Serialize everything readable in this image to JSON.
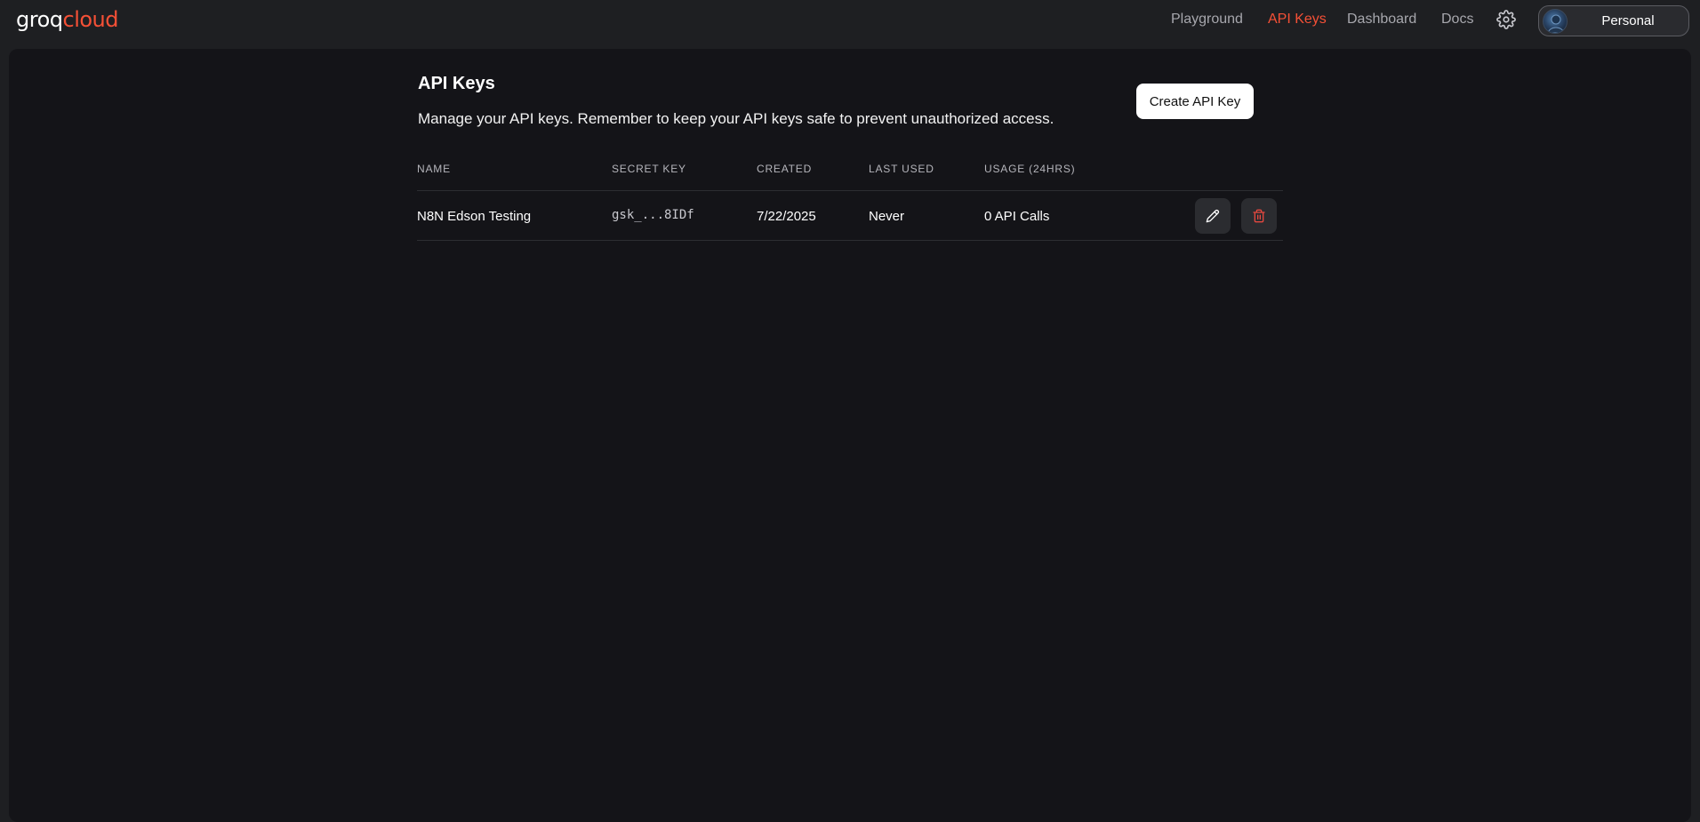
{
  "brand": {
    "part1": "groq",
    "part2": "cloud"
  },
  "nav": {
    "playground": "Playground",
    "api_keys": "API Keys",
    "dashboard": "Dashboard",
    "docs": "Docs",
    "active": "API Keys"
  },
  "account": {
    "label": "Personal"
  },
  "page": {
    "title": "API Keys",
    "description": "Manage your API keys. Remember to keep your API keys safe to prevent unauthorized access.",
    "create_button": "Create API Key"
  },
  "table": {
    "headers": {
      "name": "NAME",
      "secret_key": "SECRET KEY",
      "created": "CREATED",
      "last_used": "LAST USED",
      "usage": "USAGE (24HRS)"
    },
    "rows": [
      {
        "name": "N8N Edson Testing",
        "secret_key": "gsk_...8IDf",
        "created": "7/22/2025",
        "last_used": "Never",
        "usage": "0 API Calls"
      }
    ]
  },
  "colors": {
    "accent": "#f55036",
    "page_bg": "#141418",
    "topbar_bg": "#1e1f22",
    "delete_icon": "#e5483f"
  },
  "icons": {
    "settings": "gear-icon",
    "edit": "pencil-icon",
    "delete": "trash-icon"
  }
}
